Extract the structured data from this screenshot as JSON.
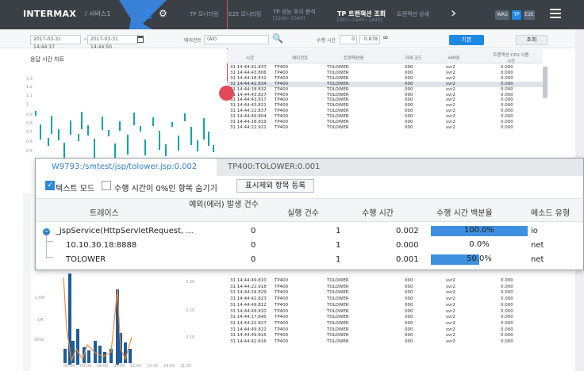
{
  "topbar": {
    "brand": "INTERMAX",
    "service": "/ 서비스1",
    "nav_items": [
      "TP 모니터링",
      "E2E 모니터링",
      "TP 성능 추이 분석"
    ],
    "nav_sub": "[1240~1540]",
    "active_tab": "TP 트랜잭션 조회",
    "active_sub": "[001~1440~1440]",
    "next_tab": "트랜잭션 상세",
    "right_buttons": [
      "WAS",
      "TP",
      "E2E"
    ]
  },
  "filters": {
    "from_time": "2017-03-31 14:44:17",
    "to_time": "2017-03-31 14:44:50",
    "agent_label": "에이전트",
    "agent_value": "(All)",
    "exec_label": "수행 시간",
    "exec_from": "0",
    "exec_to": "0.878",
    "inf": "∞",
    "apply": "기본",
    "search": "조회"
  },
  "left_chart": {
    "title": "응답 시간 차트",
    "y_ticks": [
      "1.3",
      "1.2",
      "1.1",
      "1",
      "0.9",
      "0.8",
      "0.7",
      "0.6",
      "0.5"
    ]
  },
  "table": {
    "headers": [
      "시간",
      "에이전트",
      "트랜잭션명",
      "거래 코드",
      "서버명",
      "트랜잭션 CPU 사용 시간"
    ],
    "rows": [
      [
        "31 14:44:41.837",
        "TP400",
        "TOLOWER",
        "000",
        "svr2",
        "0.000"
      ],
      [
        "31 14:44:43.806",
        "TP400",
        "TOLOWER",
        "000",
        "svr2",
        "0.000"
      ],
      [
        "31 14:44:18.831",
        "TP400",
        "TOLOWER",
        "000",
        "svr2",
        "0.000"
      ],
      [
        "31 14:44:42.834",
        "TP400",
        "TOLOWER",
        "000",
        "svr2",
        "0.000"
      ],
      [
        "31 14:44:18.832",
        "TP400",
        "TOLOWER",
        "000",
        "svr2",
        "0.000"
      ],
      [
        "31 14:44:43.827",
        "TP400",
        "TOLOWER",
        "000",
        "svr2",
        "0.000"
      ],
      [
        "31 14:44:43.817",
        "TP400",
        "TOLOWER",
        "000",
        "svr2",
        "0.000"
      ],
      [
        "31 14:44:43.821",
        "TP400",
        "TOLOWER",
        "000",
        "svr2",
        "0.000"
      ],
      [
        "31 14:44:22.837",
        "TP400",
        "TOLOWER",
        "000",
        "svr2",
        "0.000"
      ],
      [
        "31 14:44:49.804",
        "TP400",
        "TOLOWER",
        "000",
        "svr2",
        "0.000"
      ],
      [
        "31 14:44:18.819",
        "TP400",
        "TOLOWER",
        "000",
        "svr2",
        "0.000"
      ],
      [
        "31 14:44:22.921",
        "TP400",
        "TOLOWER",
        "000",
        "svr2",
        "0.000"
      ]
    ],
    "bottom_rows": [
      [
        "31 14:44:49.810",
        "TP400",
        "TOLOWER",
        "000",
        "svr2",
        "0.000"
      ],
      [
        "31 14:44:22.918",
        "TP400",
        "TOLOWER",
        "000",
        "svr2",
        "0.000"
      ],
      [
        "31 14:44:18.829",
        "TP400",
        "TOLOWER",
        "000",
        "svr2",
        "0.000"
      ],
      [
        "31 14:44:42.823",
        "TP400",
        "TOLOWER",
        "000",
        "svr2",
        "0.000"
      ],
      [
        "31 14:44:49.812",
        "TP400",
        "TOLOWER",
        "000",
        "svr2",
        "0.000"
      ],
      [
        "31 14:44:49.820",
        "TP400",
        "TOLOWER",
        "000",
        "svr2",
        "0.000"
      ],
      [
        "31 14:44:17.845",
        "TP400",
        "TOLOWER",
        "000",
        "svr2",
        "0.000"
      ],
      [
        "31 14:44:22.827",
        "TP400",
        "TOLOWER",
        "000",
        "svr2",
        "0.000"
      ],
      [
        "31 14:44:49.822",
        "TP400",
        "TOLOWER",
        "000",
        "svr2",
        "0.000"
      ],
      [
        "31 14:44:49.816",
        "TP400",
        "TOLOWER",
        "000",
        "svr2",
        "0.000"
      ],
      [
        "31 14:44:42.816",
        "TP400",
        "TOLOWER",
        "000",
        "svr2",
        "0.000"
      ]
    ]
  },
  "lower_chart": {
    "y_ticks_left": [
      "1.5M",
      "1M",
      "500k"
    ],
    "y_ticks_right": [
      "0.30",
      "0.20",
      "0.10"
    ],
    "x_ticks": [
      "00:00",
      "03:00",
      "06:00",
      "09:00",
      "12:00",
      "15:00",
      "18:00",
      "21:00"
    ]
  },
  "popup": {
    "tab1": "W9793:/smtest/jsp/tolower.jsp:0.002",
    "tab2": "TP400:TOLOWER:0.001",
    "checkbox1": "텍스트 모드",
    "checkbox2": "수행 시간이 0%인 항목 숨기기",
    "register_button": "표시제외 항목 등록",
    "headers": {
      "trace": "트레이스",
      "exception": "예외(에러) 발생 건수",
      "count": "실행 건수",
      "elapsed": "수행 시간",
      "percent": "수행 시간 백분율",
      "method": "메소드 유형"
    },
    "rows": [
      {
        "trace": "_jspService(HttpServletRequest, ...",
        "exception": "0",
        "count": "1",
        "elapsed": "0.002",
        "percent": "100.0%",
        "percent_value": 100,
        "method": "io"
      },
      {
        "trace": "10.10.30.18:8888",
        "exception": "0",
        "count": "1",
        "elapsed": "0.000",
        "percent": "0.0%",
        "percent_value": 0,
        "method": "net"
      },
      {
        "trace": "TOLOWER",
        "exception": "0",
        "count": "1",
        "elapsed": "0.001",
        "percent": "50.0%",
        "percent_value": 50,
        "method": "net"
      }
    ]
  },
  "colors": {
    "topbar": "#3b4047",
    "accent": "#1e88e5",
    "chart_teal": "#14a3a8",
    "bar_blue": "#1f5c99",
    "marker_red": "#e24a5a"
  }
}
